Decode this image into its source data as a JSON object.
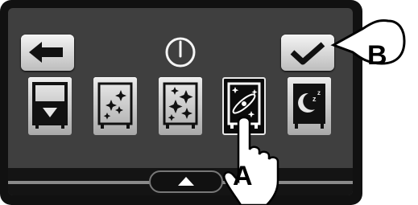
{
  "topbar": {
    "back_icon": "arrow-left-icon",
    "power_icon": "power-icon",
    "confirm_icon": "checkmark-icon"
  },
  "modes": [
    {
      "icon": "drawer-down-icon",
      "selected": false
    },
    {
      "icon": "sparkle-small-icon",
      "selected": false
    },
    {
      "icon": "sparkle-large-icon",
      "selected": false
    },
    {
      "icon": "fan-sparkle-icon",
      "selected": true
    },
    {
      "icon": "moon-sleep-icon",
      "selected": false
    }
  ],
  "bottom": {
    "up_icon": "triangle-up-icon"
  },
  "callouts": {
    "a": "A",
    "b": "B"
  },
  "colors": {
    "screen": "#3f3f3f",
    "button": "#e6e6e6",
    "selected": "#0a0a0a"
  }
}
